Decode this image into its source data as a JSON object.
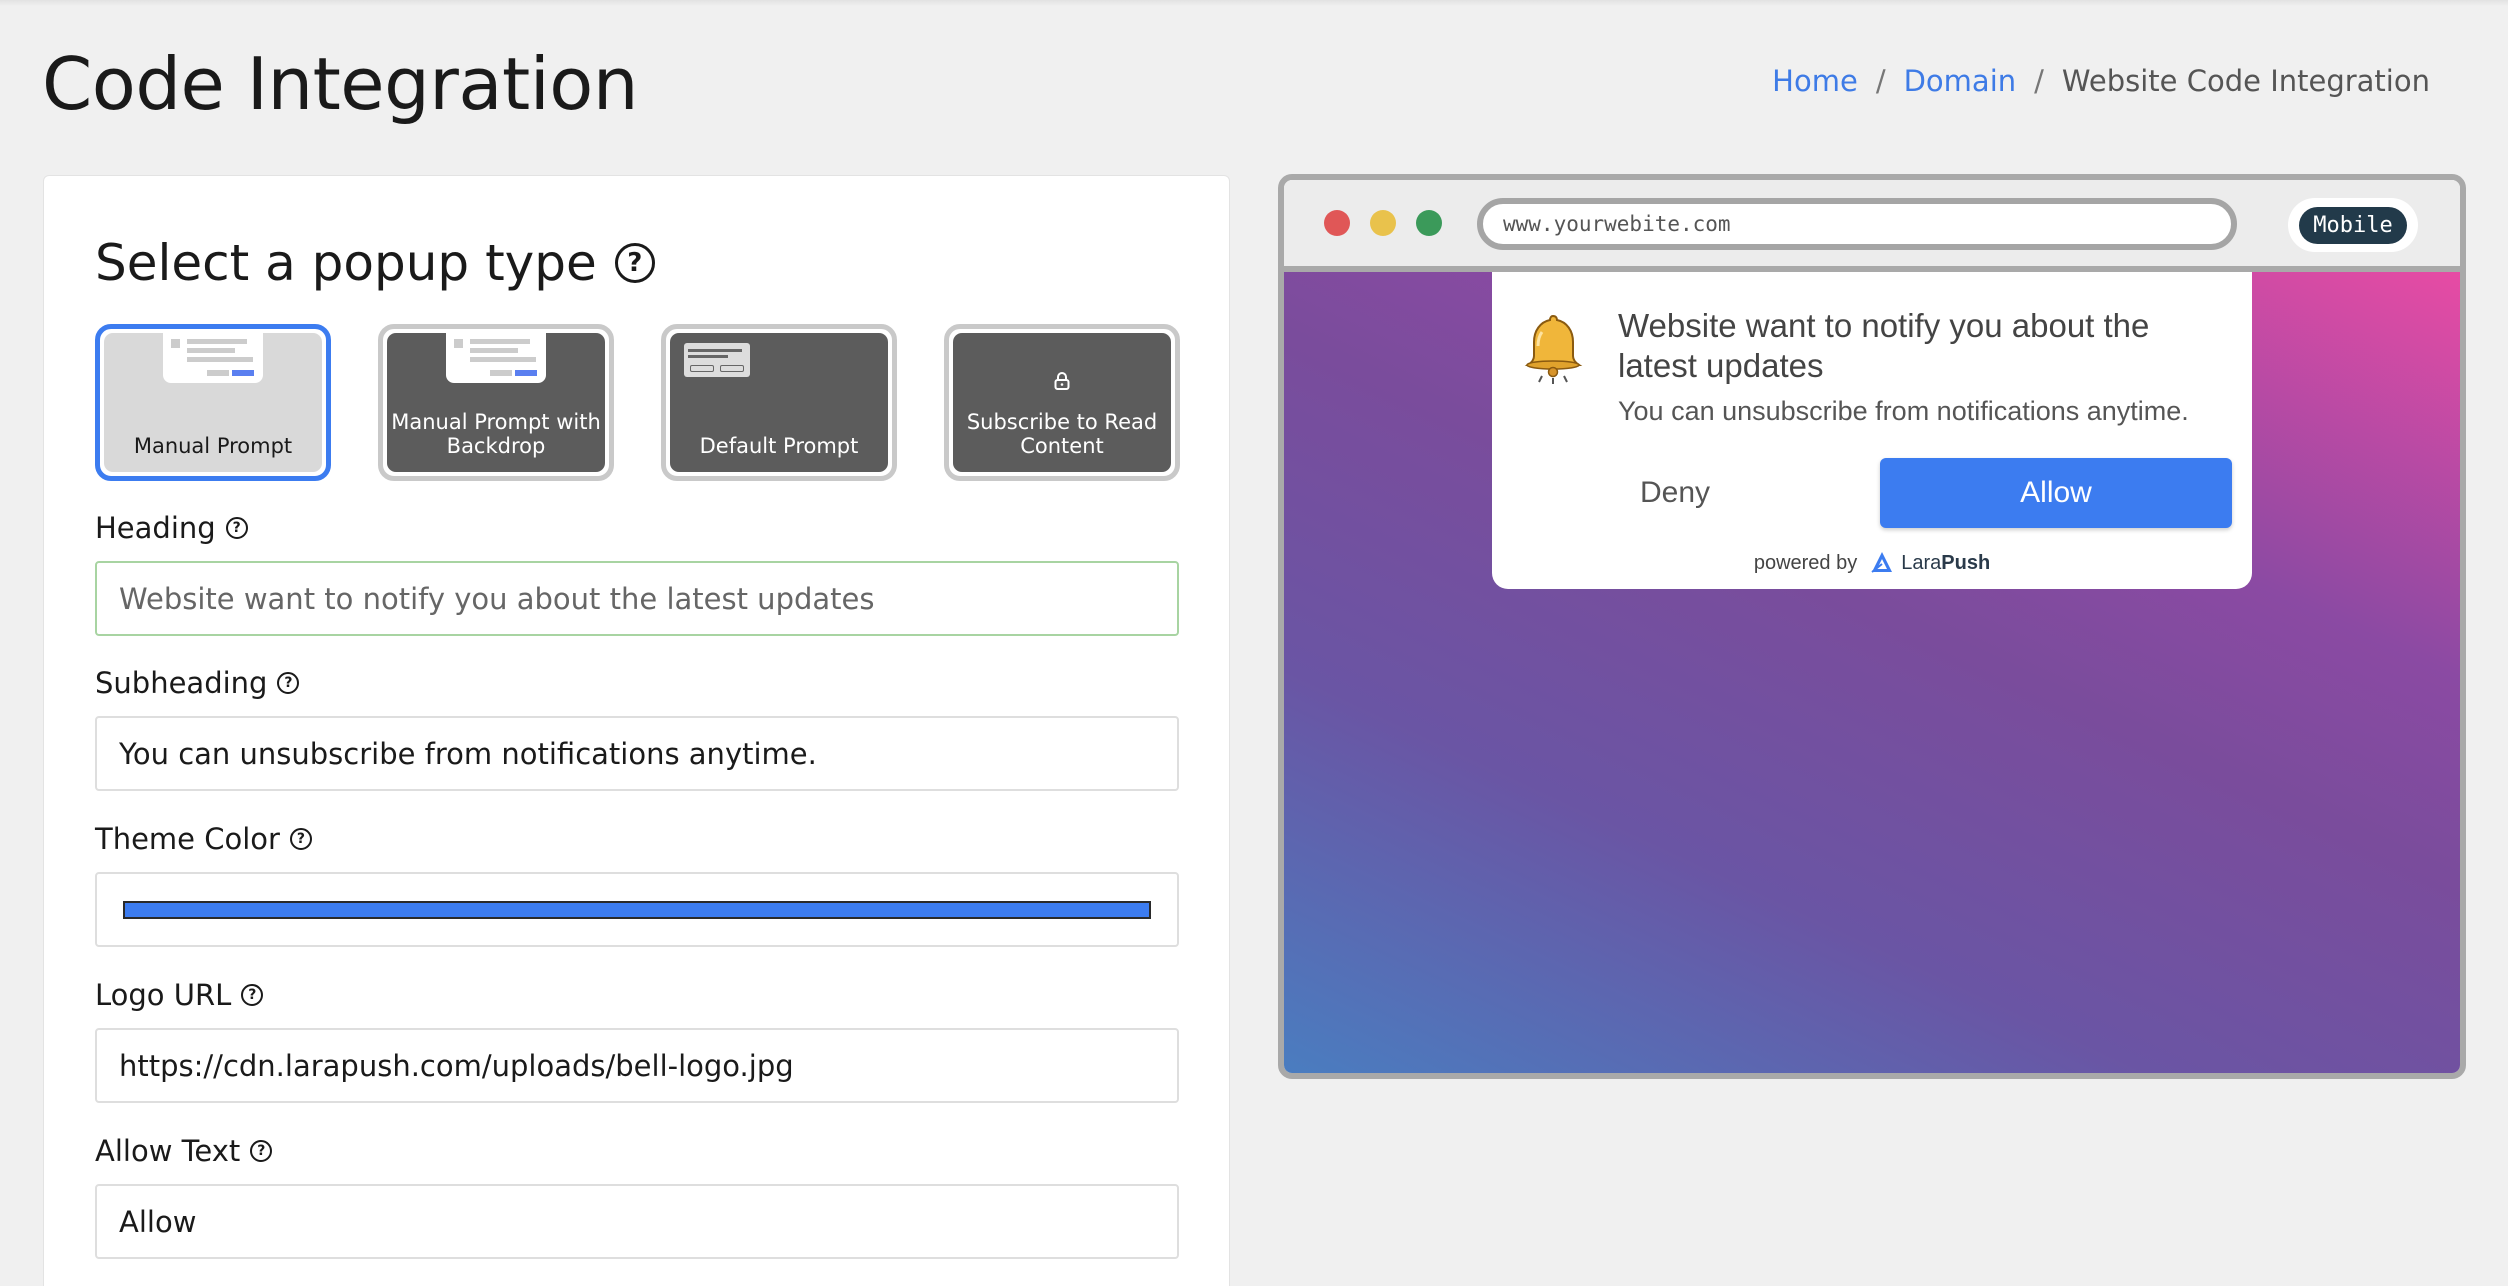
{
  "header": {
    "title": "Code Integration",
    "breadcrumb": {
      "home": "Home",
      "domain": "Domain",
      "current": "Website Code Integration",
      "separator": "/"
    }
  },
  "form": {
    "section_title": "Select a popup type",
    "popup_types": [
      {
        "label": "Manual Prompt",
        "selected": true
      },
      {
        "label": "Manual Prompt with Backdrop",
        "selected": false
      },
      {
        "label": "Default Prompt",
        "selected": false
      },
      {
        "label": "Subscribe to Read Content",
        "selected": false
      }
    ],
    "heading": {
      "label": "Heading",
      "value": "Website want to notify you about the latest updates"
    },
    "subheading": {
      "label": "Subheading",
      "value": "You can unsubscribe from notifications anytime."
    },
    "theme_color": {
      "label": "Theme Color",
      "value": "#3c7cf0"
    },
    "logo_url": {
      "label": "Logo URL",
      "value": "https://cdn.larapush.com/uploads/bell-logo.jpg"
    },
    "allow_text": {
      "label": "Allow Text",
      "value": "Allow"
    }
  },
  "preview": {
    "url": "www.yourwebite.com",
    "device_button": "Mobile",
    "popup": {
      "heading": "Website want to notify you about the latest updates",
      "subheading": "You can unsubscribe from notifications anytime.",
      "deny": "Deny",
      "allow": "Allow",
      "powered_by": "powered by",
      "brand_light": "Lara",
      "brand_bold": "Push"
    },
    "icons": [
      "bell-icon",
      "larapush-logo-icon"
    ]
  },
  "colors": {
    "accent": "#3c7cf0",
    "link": "#3e7be6",
    "dot_red": "#e05757",
    "dot_yellow": "#e9c24c",
    "dot_green": "#3b9a5a"
  }
}
